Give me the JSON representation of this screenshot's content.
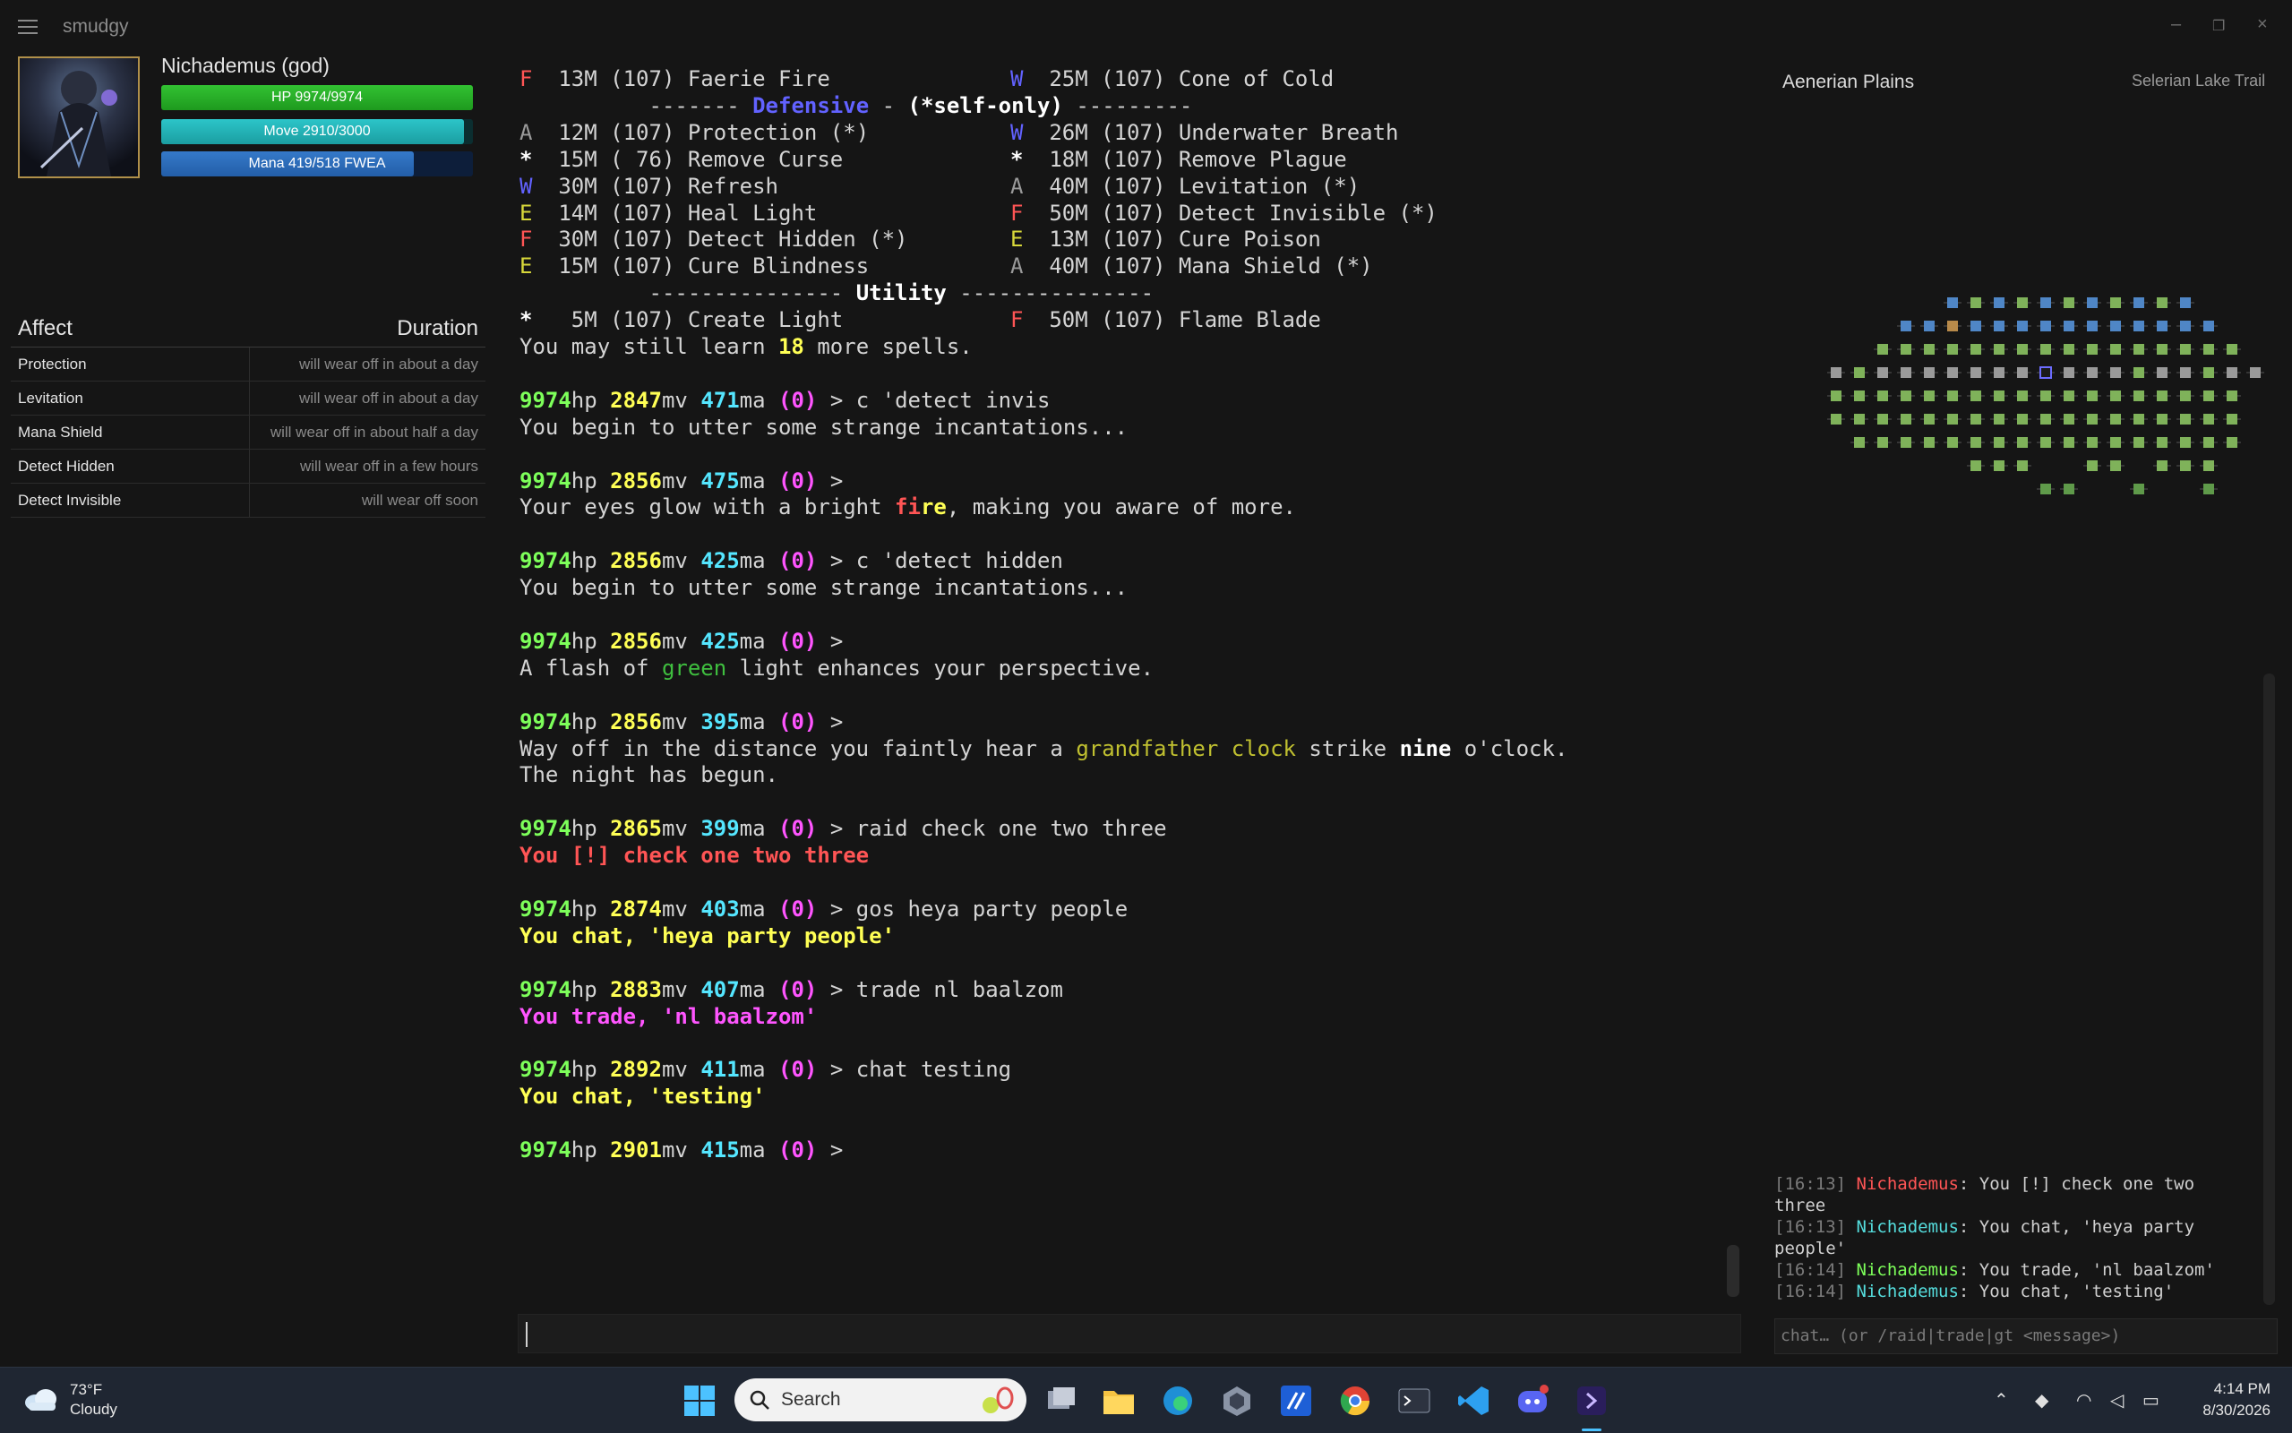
{
  "app": {
    "title": "smudgy"
  },
  "character": {
    "name": "Nichademus (god)",
    "hp_label": "HP 9974/9974",
    "hp_fraction": 1.0,
    "move_label": "Move 2910/3000",
    "move_fraction": 0.97,
    "mana_label": "Mana 419/518  FWEA",
    "mana_fraction": 0.81
  },
  "affects": {
    "header_affect": "Affect",
    "header_duration": "Duration",
    "rows": [
      {
        "name": "Protection",
        "duration": "will wear off in about a day"
      },
      {
        "name": "Levitation",
        "duration": "will wear off in about a day"
      },
      {
        "name": "Mana Shield",
        "duration": "will wear off in about half a day"
      },
      {
        "name": "Detect Hidden",
        "duration": "will wear off in a few hours"
      },
      {
        "name": "Detect Invisible",
        "duration": "will wear off soon"
      }
    ]
  },
  "terminal": {
    "spells_top": {
      "l_code": "F",
      "l_text": "13M (107) Faerie Fire",
      "r_code": "W",
      "r_text": "25M (107) Cone of Cold"
    },
    "defensive_header": {
      "pre": "------- ",
      "word": "Defensive",
      "mid": " - ",
      "note": "(*self-only)",
      "post": " ---------"
    },
    "defensive": [
      {
        "l_code": "A",
        "l_text": "12M (107) Protection (*)",
        "r_code": "W",
        "r_text": "26M (107) Underwater Breath"
      },
      {
        "l_code": "*",
        "l_text": "15M ( 76) Remove Curse",
        "r_code": "*",
        "r_text": "18M (107) Remove Plague"
      },
      {
        "l_code": "W",
        "l_text": "30M (107) Refresh",
        "r_code": "A",
        "r_text": "40M (107) Levitation (*)"
      },
      {
        "l_code": "E",
        "l_text": "14M (107) Heal Light",
        "r_code": "F",
        "r_text": "50M (107) Detect Invisible (*)"
      },
      {
        "l_code": "F",
        "l_text": "30M (107) Detect Hidden (*)",
        "r_code": "E",
        "r_text": "13M (107) Cure Poison"
      },
      {
        "l_code": "E",
        "l_text": "15M (107) Cure Blindness",
        "r_code": "A",
        "r_text": "40M (107) Mana Shield (*)"
      }
    ],
    "utility_header": {
      "pre": "--------------- ",
      "word": "Utility",
      "post": " ---------------"
    },
    "utility": {
      "l_code": "*",
      "l_text": " 5M (107) Create Light",
      "r_code": "F",
      "r_text": "50M (107) Flame Blade"
    },
    "learn": {
      "pre": "You may still learn ",
      "num": "18",
      "post": " more spells."
    },
    "prompts": [
      {
        "hp": "9974",
        "mv": "2847",
        "ma": "471",
        "cmd": " > c 'detect invis"
      },
      {
        "hp": "9974",
        "mv": "2856",
        "ma": "475",
        "cmd": " >"
      },
      {
        "hp": "9974",
        "mv": "2856",
        "ma": "425",
        "cmd": " > c 'detect hidden"
      },
      {
        "hp": "9974",
        "mv": "2856",
        "ma": "425",
        "cmd": " >"
      },
      {
        "hp": "9974",
        "mv": "2856",
        "ma": "395",
        "cmd": " >"
      },
      {
        "hp": "9974",
        "mv": "2865",
        "ma": "399",
        "cmd": " > raid check one two three"
      },
      {
        "hp": "9974",
        "mv": "2874",
        "ma": "403",
        "cmd": " > gos heya party people"
      },
      {
        "hp": "9974",
        "mv": "2883",
        "ma": "407",
        "cmd": " > trade nl baalzom"
      },
      {
        "hp": "9974",
        "mv": "2892",
        "ma": "411",
        "cmd": " > chat testing"
      },
      {
        "hp": "9974",
        "mv": "2901",
        "ma": "415",
        "cmd": " >"
      }
    ],
    "hp_suffix": "hp",
    "mv_suffix": "mv",
    "ma_suffix": "ma",
    "zero": "(0)",
    "out_incant_1": "You begin to utter some strange incantations...",
    "out_eyes": {
      "pre": "Your eyes glow with a bright ",
      "fi": "fi",
      "re": "re",
      "post": ", making you aware of more."
    },
    "out_incant_2": "You begin to utter some strange incantations...",
    "out_flash": {
      "pre": "A flash of ",
      "green": "green",
      "post": " light enhances your perspective."
    },
    "out_clock": {
      "pre": "Way off in the distance you faintly hear a ",
      "clock": "grandfather clock",
      "mid": " strike ",
      "nine": "nine",
      "post": " o'clock."
    },
    "out_night": "The night has begun.",
    "out_raid": "You [!] check one two three",
    "out_gos": "You chat, 'heya party people'",
    "out_trade": "You trade, 'nl baalzom'",
    "out_chat": "You chat, 'testing'"
  },
  "map": {
    "area": "Aenerian Plains",
    "room": "Selerian Lake Trail"
  },
  "chat": {
    "lines": [
      {
        "ts": "[16:13]",
        "who": "Nichademus",
        "msg": ": You [!] check one two three"
      },
      {
        "ts": "[16:13]",
        "who": "Nichademus",
        "msg": ": You chat, 'heya party people'"
      },
      {
        "ts": "[16:14]",
        "who": "Nichademus",
        "msg": ": You trade, 'nl baalzom'"
      },
      {
        "ts": "[16:14]",
        "who": "Nichademus",
        "msg": ": You chat, 'testing'"
      }
    ],
    "placeholder": "chat… (or /raid|trade|gt <message>)"
  },
  "taskbar": {
    "temp": "73°F",
    "condition": "Cloudy",
    "search_label": "Search",
    "time": "4:14 PM",
    "date": "8/30/2026",
    "colors": {
      "code_F": "#ff5555",
      "code_W": "#6262ff",
      "code_A": "#9a9a9a",
      "code_E": "#d8d83a",
      "code_star": "#ffffff"
    }
  }
}
